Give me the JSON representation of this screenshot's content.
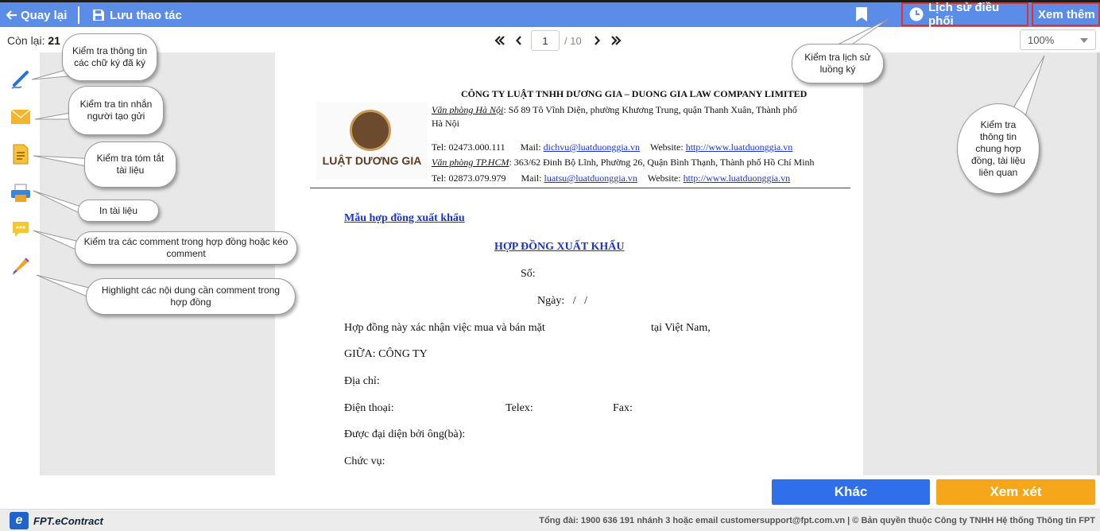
{
  "topbar": {
    "back_label": "Quay lại",
    "save_label": "Lưu thao tác",
    "history_label": "Lịch sử điều phối",
    "more_label": "Xem thêm"
  },
  "status": {
    "remaining_label": "Còn lại:",
    "remaining_value": "21"
  },
  "pager": {
    "current_page": "1",
    "total": "/ 10"
  },
  "zoom": {
    "value": "100%"
  },
  "tools": [
    {
      "name": "signature-tool",
      "icon": "pen-icon"
    },
    {
      "name": "message-tool",
      "icon": "envelope-icon"
    },
    {
      "name": "summary-tool",
      "icon": "document-icon"
    },
    {
      "name": "print-tool",
      "icon": "printer-icon"
    },
    {
      "name": "comment-tool",
      "icon": "chat-bubble-icon"
    },
    {
      "name": "highlight-tool",
      "icon": "highlighter-icon"
    }
  ],
  "callouts": {
    "signatures": "Kiểm tra thông tin các chữ ký đã ký",
    "message": "Kiểm tra tin nhắn người tạo gửi",
    "summary": "Kiểm tra tóm tắt tài liệu",
    "print": "In tài liệu",
    "comments": "Kiểm tra các comment trong hợp đồng hoặc kéo comment",
    "highlight": "Highlight các nội dung cần comment trong hợp đồng",
    "history": "Kiểm tra lịch sử luồng ký",
    "general": "Kiểm tra thông tin chung hợp đồng, tài liệu liên quan"
  },
  "letterhead": {
    "company": "CÔNG TY LUẬT TNHH DƯƠNG GIA – DUONG GIA LAW COMPANY LIMITED",
    "logo_text": "LUẬT DƯƠNG GIA",
    "hn_office_label": "Văn phòng Hà Nội",
    "hn_address": ": Số 89 Tô Vĩnh Diện, phường Khương Trung, quận Thanh Xuân, Thành phố",
    "hn_address_2": "Hà Nội",
    "hn_tel": "Tel: 02473.000.111",
    "hn_mail_label": "Mail:",
    "hn_mail": "dichvu@luatduonggia.vn",
    "website_label": "Website:",
    "website": "http://www.luatduonggia.vn",
    "hcm_office_label": "Văn phòng TP.HCM",
    "hcm_address": ": 363/62 Đinh Bộ Lĩnh, Phường 26, Quận Bình Thạnh, Thành phố Hồ Chí Minh",
    "hcm_tel": "Tel: 02873.079.979",
    "hcm_mail_label": "Mail:",
    "hcm_mail": "luatsu@luatduonggia.vn",
    "website_2": "http://www.luatduonggia.vn"
  },
  "document": {
    "template_link": "Mẫu hợp đồng xuất khẩu",
    "title": "HỢP ĐỒNG XUẤT KHẨU",
    "number": "Số:",
    "date": "Ngày:   /   /",
    "intro": "Hợp đồng này xác nhận việc mua và bán mặt",
    "intro_tail": "tại Việt Nam,",
    "between": "GIỮA: CÔNG TY",
    "address": "Địa chỉ:",
    "phone": "Điện thoại:",
    "telex": "Telex:",
    "fax": "Fax:",
    "represented": "Được đại diện bởi ông(bà):",
    "position": "Chức vụ:"
  },
  "actions": {
    "other_label": "Khác",
    "review_label": "Xem xét"
  },
  "footer": {
    "brand": "FPT.eContract",
    "logo_letter": "e",
    "text": "Tổng đài: 1900 636 191 nhánh 3 hoặc email customersupport@fpt.com.vn | © Bản quyền thuộc Công ty TNHH Hệ thống Thông tin FPT"
  },
  "colors": {
    "topbar": "#5b8de8",
    "other_button": "#2f6fec",
    "review_button": "#f6a61b",
    "highlight_border": "#e03030"
  }
}
